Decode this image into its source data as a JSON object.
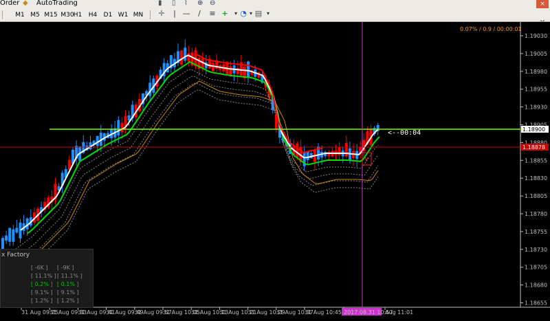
{
  "menubar": {
    "order_label": "Order",
    "autotrading_label": "AutoTrading",
    "close_label": "×"
  },
  "timeframes": [
    "M1",
    "M5",
    "M15",
    "M30",
    "H1",
    "H4",
    "D1",
    "W1",
    "MN"
  ],
  "chart": {
    "spread_info": "0.07% / 0.9 / 00:00:01",
    "timer_label": "<--00:04",
    "current_price_label": "1.18900",
    "bid_price_label": "1.18878",
    "y_ticks": [
      "1.19030",
      "1.19005",
      "1.18980",
      "1.18955",
      "1.18930",
      "1.18905",
      "1.18880",
      "1.18855",
      "1.18830",
      "1.18805",
      "1.18780",
      "1.18755",
      "1.18730",
      "1.18705",
      "1.18680",
      "1.18655"
    ],
    "x_ticks": [
      "31 Aug 09:25",
      "31 Aug 09:33",
      "31 Aug 09:41",
      "31 Aug 09:49",
      "31 Aug 09:57",
      "31 Aug 10:05",
      "31 Aug 10:13",
      "31 Aug 10:21",
      "31 Aug 10:29",
      "31 Aug 10:37",
      "31 Aug 10:45",
      "2017.08.31 10:57",
      "Aug 11:01"
    ],
    "colors": {
      "bull": "#1e90ff",
      "bear": "#ff0000",
      "white_ma": "#ffffff",
      "green_ma": "#00dd00",
      "red_ma": "#ff0000",
      "orange_ma": "#cc8800",
      "hline_green": "#7cfc00",
      "hline_red": "#cc0000",
      "vline": "#cc33cc"
    }
  },
  "info_panel": {
    "title": "x Factory",
    "rows": [
      [
        "[ -6K ]",
        "[ -9K ]"
      ],
      [
        "[ 11.1% ]",
        "[ 11.1% ]"
      ],
      [
        "[ 0.2% ]",
        "[ 0.1% ]"
      ],
      [
        "[ 9.1% ]",
        "[ 9.1% ]"
      ],
      [
        "[ 1.2% ]",
        "[ 1.2% ]"
      ]
    ],
    "row_colors": [
      "#888888",
      "#888888",
      "#00cc00",
      "#888888",
      "#888888"
    ]
  }
}
